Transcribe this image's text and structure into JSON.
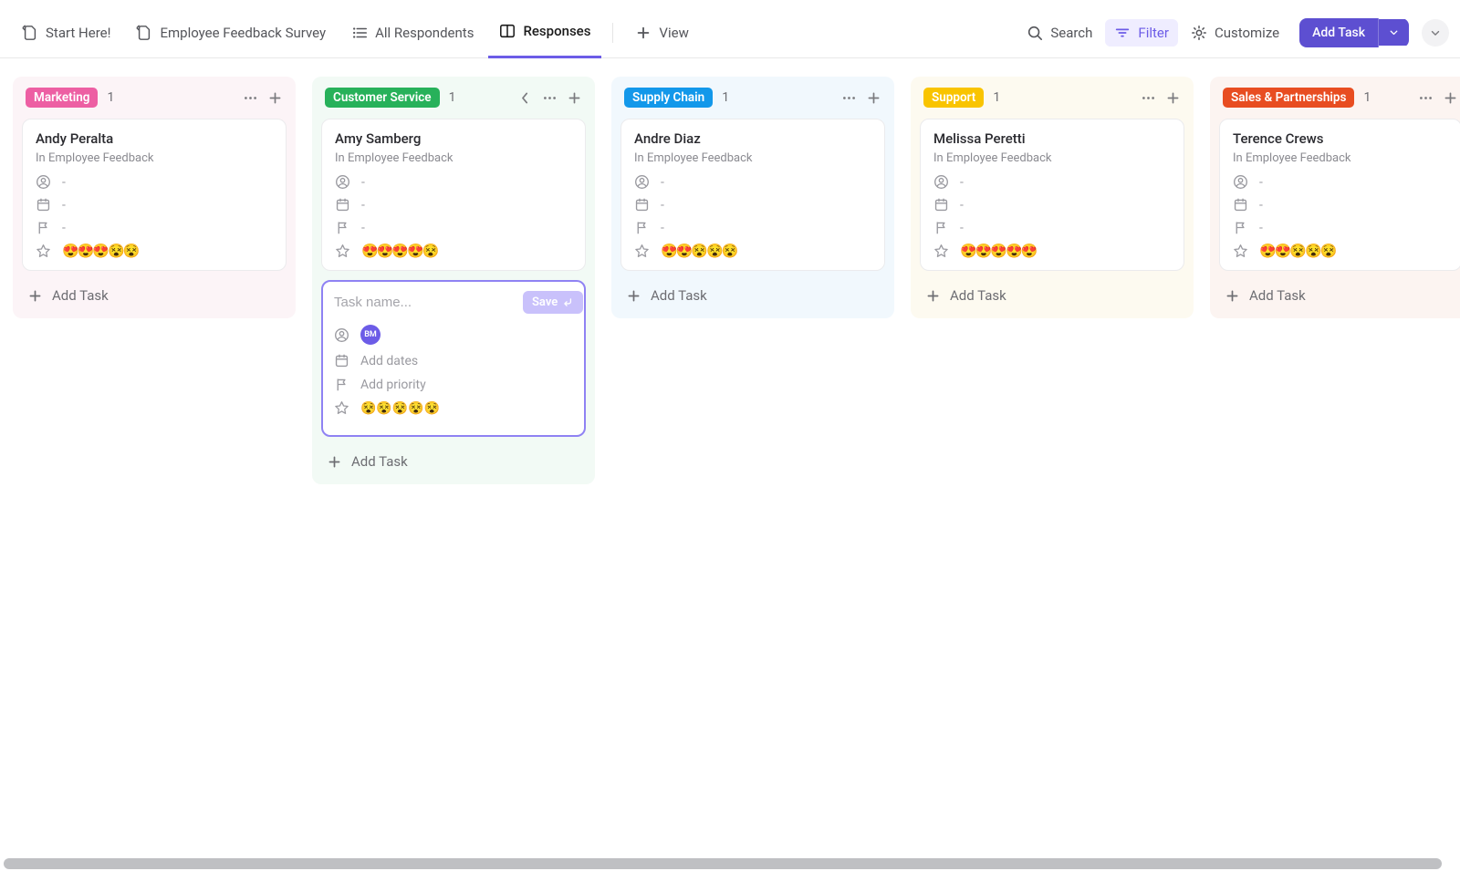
{
  "toolbar": {
    "tabs": [
      "Start Here!",
      "Employee Feedback Survey",
      "All Respondents",
      "Responses"
    ],
    "view_label": "View",
    "search_label": "Search",
    "filter_label": "Filter",
    "customize_label": "Customize",
    "add_task_label": "Add Task"
  },
  "new_task": {
    "placeholder": "Task name...",
    "save_label": "Save",
    "avatar_initials": "BM",
    "add_dates": "Add dates",
    "add_priority": "Add priority",
    "rating_emojis": "😵😵😵😵😵"
  },
  "add_task_row": "Add Task",
  "columns": [
    {
      "id": "marketing",
      "name": "Marketing",
      "count": "1",
      "badge_bg": "#ed5fa3",
      "tint_class": "col-marketing",
      "extra_head_icons": [],
      "has_new_task": false,
      "cards": [
        {
          "title": "Andy Peralta",
          "subtitle": "In Employee Feedback",
          "assignee": "-",
          "date": "-",
          "priority": "-",
          "rating": "😍😍😍😵😵"
        }
      ]
    },
    {
      "id": "customer-service",
      "name": "Customer Service",
      "count": "1",
      "badge_bg": "#27b15a",
      "tint_class": "col-customer",
      "extra_head_icons": [
        "chevron-left"
      ],
      "has_new_task": true,
      "cards": [
        {
          "title": "Amy Samberg",
          "subtitle": "In Employee Feedback",
          "assignee": "-",
          "date": "-",
          "priority": "-",
          "rating": "😍😍😍😍😵"
        }
      ]
    },
    {
      "id": "supply-chain",
      "name": "Supply Chain",
      "count": "1",
      "badge_bg": "#1398ea",
      "tint_class": "col-supply",
      "extra_head_icons": [],
      "has_new_task": false,
      "cards": [
        {
          "title": "Andre Diaz",
          "subtitle": "In Employee Feedback",
          "assignee": "-",
          "date": "-",
          "priority": "-",
          "rating": "😍😍😵😵😵"
        }
      ]
    },
    {
      "id": "support",
      "name": "Support",
      "count": "1",
      "badge_bg": "#f9c400",
      "tint_class": "col-support",
      "extra_head_icons": [],
      "has_new_task": false,
      "cards": [
        {
          "title": "Melissa Peretti",
          "subtitle": "In Employee Feedback",
          "assignee": "-",
          "date": "-",
          "priority": "-",
          "rating": "😍😍😍😍😍"
        }
      ]
    },
    {
      "id": "sales-partnerships",
      "name": "Sales & Partnerships",
      "count": "1",
      "badge_bg": "#e84d21",
      "tint_class": "col-sales",
      "extra_head_icons": [],
      "has_new_task": false,
      "cards": [
        {
          "title": "Terence Crews",
          "subtitle": "In Employee Feedback",
          "assignee": "-",
          "date": "-",
          "priority": "-",
          "rating": "😍😍😵😵😵"
        }
      ]
    }
  ]
}
